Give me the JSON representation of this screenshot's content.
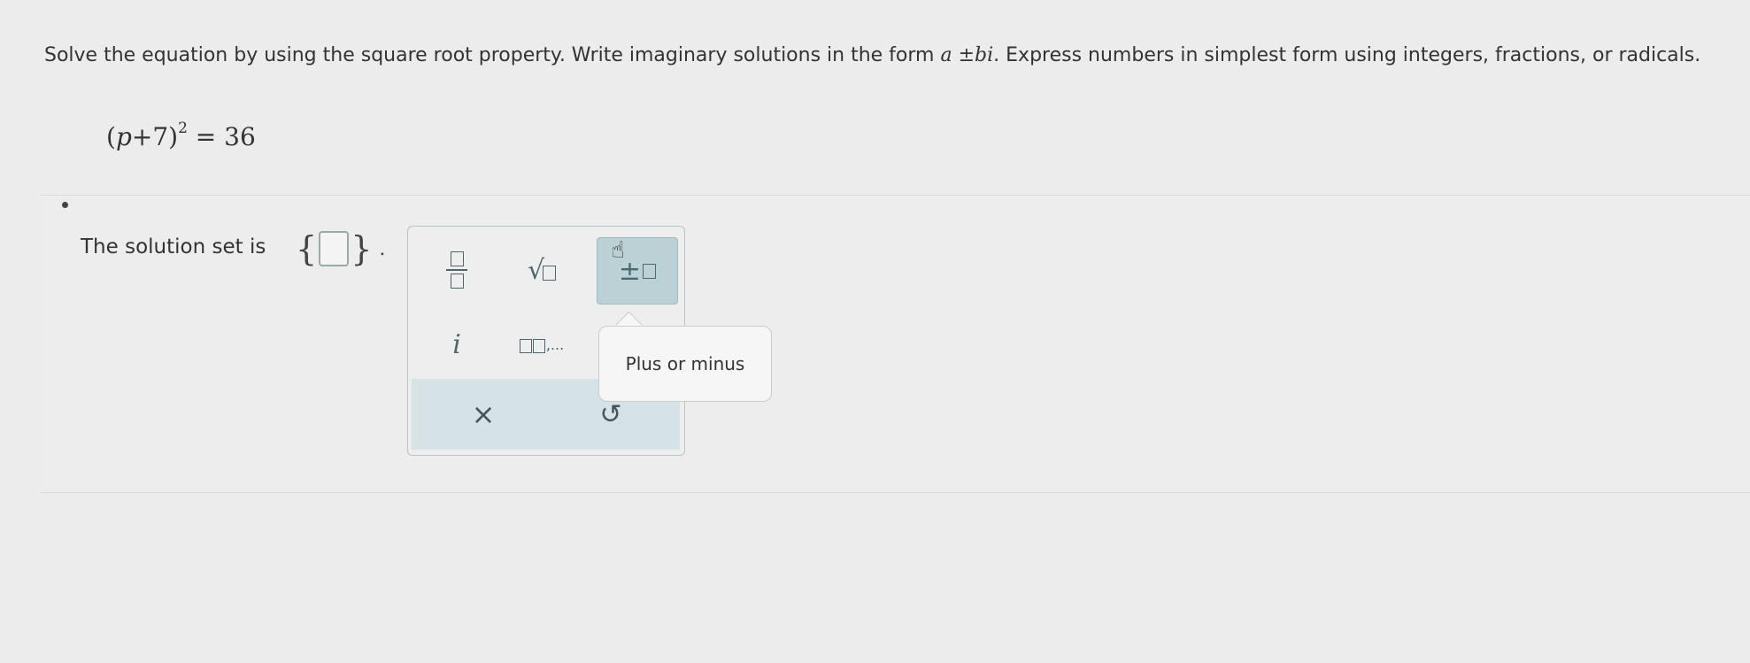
{
  "question": {
    "instructions_part1": "Solve the equation by using the square root property. Write imaginary solutions in the form ",
    "instructions_form": "a ±bi",
    "instructions_part2": ". Express numbers in simplest form using integers, fractions, or radicals.",
    "equation": {
      "open": "(",
      "variable": "p",
      "plus_constant": "+7)",
      "exponent": "2",
      "rhs": " = 36"
    }
  },
  "answer": {
    "label": "The solution set is",
    "open_brace": "{",
    "close_brace": "}",
    "period": ".",
    "value": ""
  },
  "palette": {
    "tools": [
      {
        "name": "fraction",
        "icon": "fraction-icon"
      },
      {
        "name": "square root",
        "icon": "square-root-icon"
      },
      {
        "name": "plus or minus",
        "icon": "plus-minus-icon",
        "selected": true
      },
      {
        "name": "imaginary unit",
        "icon": "imaginary-i-icon",
        "glyph": "i"
      },
      {
        "name": "list",
        "icon": "list-icon",
        "glyph": ",..."
      }
    ],
    "clear_glyph": "×",
    "undo_glyph": "↺"
  },
  "tooltip": {
    "text": "Plus or minus"
  },
  "colors": {
    "accent": "#4b6770",
    "selected_bg": "#bcd1d6",
    "footer_bg": "#d5e3e6"
  }
}
